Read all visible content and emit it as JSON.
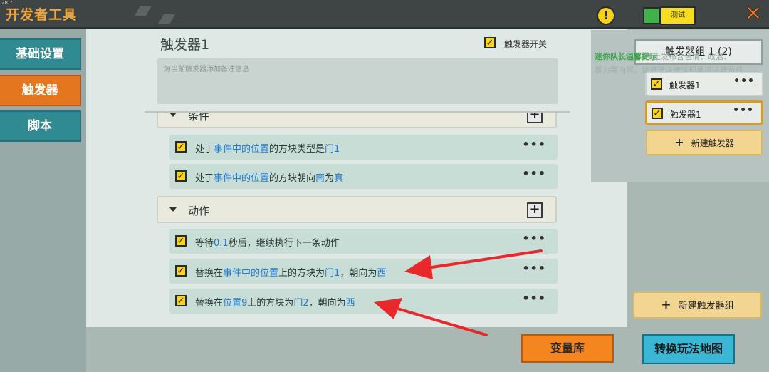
{
  "header": {
    "version": "28.7",
    "title": "开发者工具",
    "warning_icon": "!",
    "test_label": "测试",
    "close_icon": "✕"
  },
  "sidebar": {
    "items": [
      {
        "label": "基础设置"
      },
      {
        "label": "触发器"
      },
      {
        "label": "脚本"
      }
    ],
    "active_index": 1
  },
  "main": {
    "trigger_title": "触发器1",
    "trigger_switch_label": "触发器开关",
    "note_placeholder": "为当前触发器添加备注信息",
    "conditions_label": "条件",
    "conditions": [
      {
        "parts": [
          "处于",
          "事件中的位置",
          "的方块类型是",
          "门1"
        ]
      },
      {
        "parts": [
          "处于",
          "事件中的位置",
          "的方块朝向",
          "南",
          "为",
          "真"
        ]
      }
    ],
    "actions_label": "动作",
    "actions": [
      {
        "parts": [
          "等待",
          "0.1",
          "秒后，继续执行下一条动作"
        ]
      },
      {
        "parts": [
          "替换在",
          "事件中的位置",
          "上的方块为",
          "门1",
          "，朝向为",
          "西"
        ]
      },
      {
        "parts": [
          "替换在",
          "位置9",
          "上的方块为",
          "门2",
          "，朝向为",
          "西"
        ]
      }
    ]
  },
  "right_panel": {
    "group_tab_label": "触发器组 1 (2)",
    "overlay_green": "迷你队长温馨提示",
    "overlay_line1": "禁止发布含色情、政治、",
    "overlay_line2": "暴力等内容，请遵守法律法规承担法律责任",
    "triggers": [
      {
        "label": "触发器1"
      },
      {
        "label": "触发器1"
      }
    ],
    "selected_trigger_index": 1,
    "new_trigger_label": "新建触发器",
    "new_group_label": "新建触发器组"
  },
  "bottom": {
    "variable_library_label": "变量库",
    "convert_map_label": "转换玩法地图"
  },
  "colors": {
    "accent_orange": "#e3761e",
    "nav_teal": "#2f8a92",
    "highlight_blue": "#1e7bd8",
    "checkbox_yellow": "#f6d51a",
    "arrow_red": "#e8282a"
  }
}
